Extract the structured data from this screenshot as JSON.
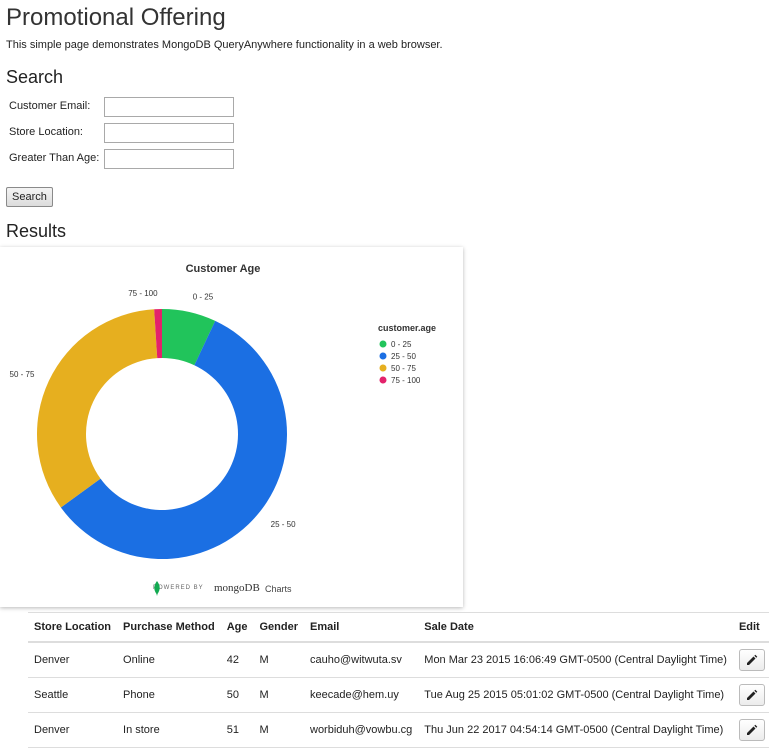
{
  "page": {
    "title": "Promotional Offering",
    "intro": "This simple page demonstrates MongoDB QueryAnywhere functionality in a web browser."
  },
  "search": {
    "heading": "Search",
    "fields": [
      {
        "label": "Customer Email:",
        "value": "",
        "placeholder": ""
      },
      {
        "label": "Store Location:",
        "value": "",
        "placeholder": ""
      },
      {
        "label": "Greater Than Age:",
        "value": "",
        "placeholder": ""
      }
    ],
    "button_label": "Search"
  },
  "results": {
    "heading": "Results"
  },
  "chart_data": {
    "type": "pie",
    "title": "Customer Age",
    "legend_title": "customer.age",
    "legend_position": "right",
    "categories": [
      "0 - 25",
      "25 - 50",
      "50 - 75",
      "75 - 100"
    ],
    "values": [
      7,
      58,
      34,
      1
    ],
    "colors": [
      "#21c45b",
      "#1b6fe3",
      "#e6af1f",
      "#e3226b"
    ],
    "donut": true
  },
  "branding": {
    "powered_by": "POWERED BY",
    "mongo": "mongoDB",
    "charts": "Charts",
    "leaf_color": "#13aa52"
  },
  "table": {
    "headers": [
      "Store Location",
      "Purchase Method",
      "Age",
      "Gender",
      "Email",
      "Sale Date",
      "Edit"
    ],
    "rows": [
      {
        "store": "Denver",
        "method": "Online",
        "age": "42",
        "gender": "M",
        "email": "cauho@witwuta.sv",
        "date": "Mon Mar 23 2015 16:06:49 GMT-0500 (Central Daylight Time)"
      },
      {
        "store": "Seattle",
        "method": "Phone",
        "age": "50",
        "gender": "M",
        "email": "keecade@hem.uy",
        "date": "Tue Aug 25 2015 05:01:02 GMT-0500 (Central Daylight Time)"
      },
      {
        "store": "Denver",
        "method": "In store",
        "age": "51",
        "gender": "M",
        "email": "worbiduh@vowbu.cg",
        "date": "Thu Jun 22 2017 04:54:14 GMT-0500 (Central Daylight Time)"
      }
    ]
  }
}
